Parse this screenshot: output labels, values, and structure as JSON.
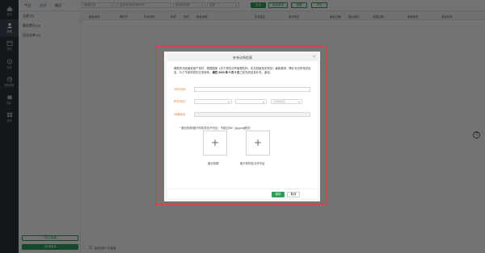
{
  "nav": {
    "items": [
      {
        "label": "首页",
        "icon": "home-icon"
      },
      {
        "label": "患者",
        "icon": "patients-icon",
        "active": true
      },
      {
        "label": "预约",
        "icon": "calendar-icon"
      },
      {
        "label": "收费",
        "icon": "billing-icon"
      },
      {
        "label": "数据报表",
        "icon": "report-icon"
      },
      {
        "label": "库存",
        "icon": "inventory-icon"
      },
      {
        "label": "更多",
        "icon": "grid-icon"
      }
    ]
  },
  "topbar": {
    "tabs": [
      "今日",
      "全部",
      "最近"
    ],
    "selects": [
      "患者信息",
      "请选择标签",
      "全部"
    ],
    "search_placeholder": "姓名/手机号/病历号",
    "buttons": [
      "查询",
      "高级查询",
      "重置",
      "导出"
    ]
  },
  "left_panel": {
    "rows": [
      "全部 (0)",
      "最近就诊 (0)",
      "回访名单 (0)"
    ],
    "import_label": "+导入患者",
    "add_label": "+新增患者"
  },
  "table": {
    "headers": [
      "患者信息",
      "病历号",
      "手机号码",
      "年龄",
      "性别",
      "患者来源",
      "初诊医生",
      "首诊医生",
      "最近日期",
      "最近就诊",
      "创建日期",
      "患者标签",
      "患者状态"
    ],
    "footer_label": "当前全部 0 位患者"
  },
  "dialog": {
    "title": "补充诊所信息",
    "close_icon": "close-icon",
    "notice_lines": [
      "尊敬的牙医管家用户您好，根据国家《关于规范诊所管理机构、实名制度相关规",
      "定》最新要求，需补充诊所相关信息，为了不影响您的正常使用，"
    ],
    "notice_deadline": "请在 2023 年 9 月 5 日",
    "notice_tail": "之前完成信息补充，谢谢。",
    "fields": {
      "clinic_name_label": "诊所名称*",
      "region_label": "所在地区*",
      "region_placeholders": [
        "省份",
        "城市",
        "请选择区县"
      ],
      "address_label": "详细地址*"
    },
    "upload_note": "* 营业执照/医疗机构执业许可证，不超过5M（jpg,png格式）",
    "upload_items": [
      "营业执照",
      "医疗机构执业许可证"
    ],
    "save_label": "保存",
    "cancel_label": "取消"
  },
  "colors": {
    "accent_green": "#2f9e5b",
    "highlight_red": "#e53935",
    "label_orange": "#e8863c",
    "nav_bg": "#2b3640"
  }
}
